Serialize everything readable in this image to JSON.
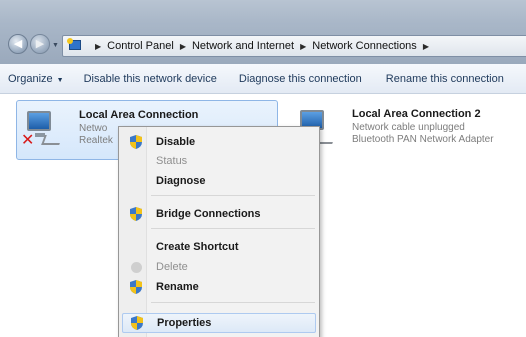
{
  "address": {
    "crumbs": [
      "Control Panel",
      "Network and Internet",
      "Network Connections"
    ]
  },
  "commands": {
    "organize": "Organize",
    "disable": "Disable this network device",
    "diagnose": "Diagnose this connection",
    "rename": "Rename this connection"
  },
  "items": [
    {
      "name": "Local Area Connection",
      "line1": "Netwo",
      "line2": "Realtek"
    },
    {
      "name": "Local Area Connection 2",
      "line1": "Network cable unplugged",
      "line2": "Bluetooth PAN Network Adapter"
    }
  ],
  "menu": {
    "disable": "Disable",
    "status": "Status",
    "diagnose": "Diagnose",
    "bridge": "Bridge Connections",
    "shortcut": "Create Shortcut",
    "delete": "Delete",
    "rename": "Rename",
    "properties": "Properties"
  },
  "colors": {
    "accent": "#1e395b",
    "shield_blue": "#3b78c8",
    "shield_yellow": "#f2c21a",
    "highlight": "#dde9f7",
    "error_red": "#d71a1a"
  }
}
